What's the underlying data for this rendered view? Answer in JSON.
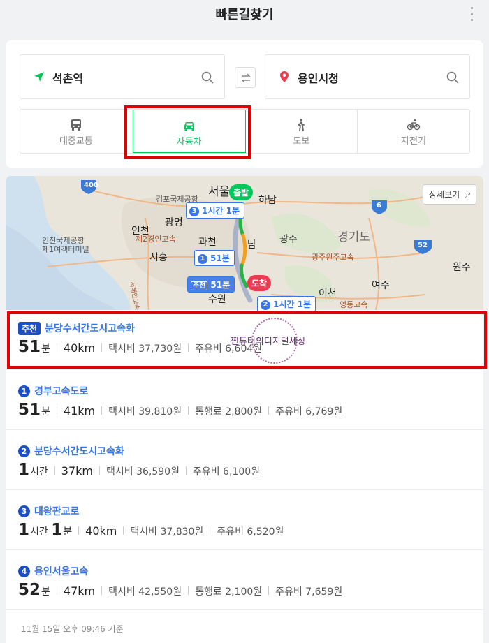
{
  "header": {
    "title": "빠른길찾기"
  },
  "search": {
    "origin": "석촌역",
    "destination": "용인시청"
  },
  "modes": [
    {
      "label": "대중교통",
      "icon": "bus-icon",
      "active": false
    },
    {
      "label": "자동차",
      "icon": "car-icon",
      "active": true
    },
    {
      "label": "도보",
      "icon": "walk-icon",
      "active": false
    },
    {
      "label": "자전거",
      "icon": "bicycle-icon",
      "active": false
    }
  ],
  "map": {
    "detail_button": "상세보기",
    "start_marker": "출발",
    "end_marker": "도착",
    "pills": {
      "route3": {
        "num": "3",
        "text": "1시간 1분"
      },
      "route1": {
        "num": "1",
        "text": "51분"
      },
      "recommended": {
        "tag": "추천",
        "text": "51분"
      },
      "route2": {
        "num": "2",
        "text": "1시간 1분"
      }
    },
    "labels": {
      "seoul": "서울",
      "gimpo": "김포국제공항",
      "gwangmyeong": "광명",
      "hanam": "하남",
      "incheon": "인천",
      "incheon_airport": "인천국제공항",
      "terminal": "제1여객터미널",
      "hwy2": "제2경인고속",
      "gwacheon": "과천",
      "siheung": "시흥",
      "nam": "남",
      "gwangju": "광주",
      "gyeonggi": "경기도",
      "gwangju_wonju": "광주원주고속",
      "wonju": "원주",
      "yeoju": "여주",
      "icheon": "이천",
      "suwon": "수원",
      "yeongdong": "영동고속",
      "seohae": "서해안고속",
      "hwy_400": "400",
      "hwy_6": "6",
      "hwy_52": "52"
    }
  },
  "watermark": "찐튜터의디지털세상",
  "routes": [
    {
      "badge": "추천",
      "name": "분당수서간도시고속화",
      "time_big": "51",
      "time_unit": "분",
      "distance": "40km",
      "taxi": "택시비 37,730원",
      "toll": "",
      "fuel": "주유비 6,604원"
    },
    {
      "badge": "1",
      "name": "경부고속도로",
      "time_big": "51",
      "time_unit": "분",
      "distance": "41km",
      "taxi": "택시비 39,810원",
      "toll": "통행료 2,800원",
      "fuel": "주유비 6,769원"
    },
    {
      "badge": "2",
      "name": "분당수서간도시고속화",
      "time_big": "1",
      "time_unit": "시간",
      "distance": "37km",
      "taxi": "택시비 36,590원",
      "toll": "",
      "fuel": "주유비 6,100원"
    },
    {
      "badge": "3",
      "name": "대왕판교로",
      "time_big": "1",
      "time_unit": "시간",
      "time_big2": "1",
      "time_unit2": "분",
      "distance": "40km",
      "taxi": "택시비 37,830원",
      "toll": "",
      "fuel": "주유비 6,520원"
    },
    {
      "badge": "4",
      "name": "용인서울고속",
      "time_big": "52",
      "time_unit": "분",
      "distance": "47km",
      "taxi": "택시비 42,550원",
      "toll": "통행료 2,100원",
      "fuel": "주유비 7,659원"
    }
  ],
  "timestamp": "11월 15일 오후 09:46 기준",
  "colors": {
    "accent_green": "#03c75a",
    "route_blue": "#3776ea",
    "badge_navy": "#1d4fc4",
    "highlight_red": "#e30000",
    "end_red": "#e93c50"
  }
}
